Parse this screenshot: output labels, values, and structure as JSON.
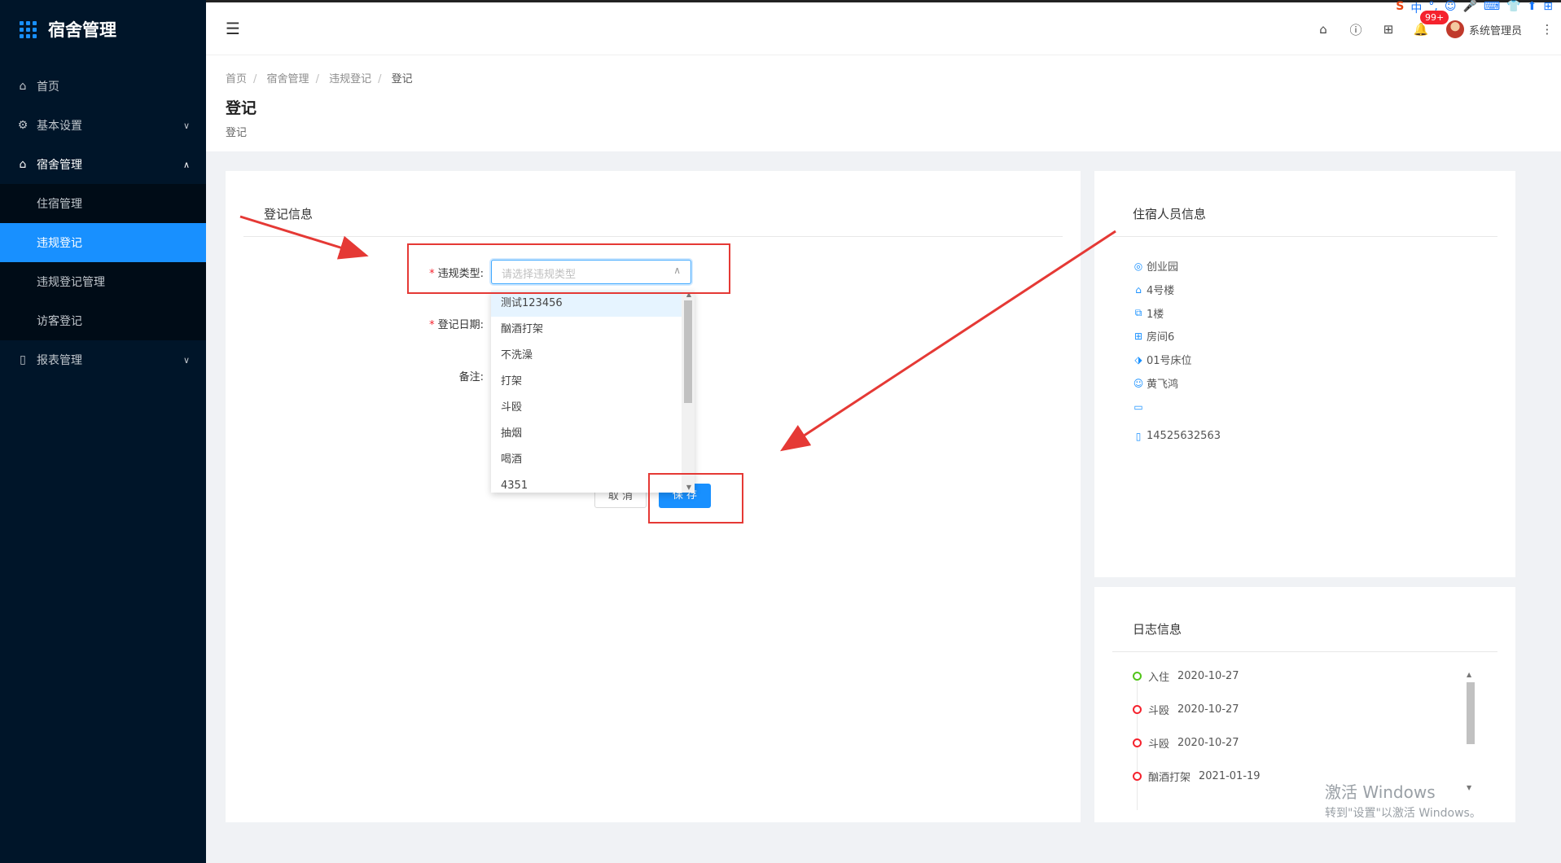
{
  "sidebar": {
    "app_title": "宿舍管理",
    "menu": [
      {
        "label": "首页",
        "icon": "home-icon"
      },
      {
        "label": "基本设置",
        "icon": "gear-icon"
      },
      {
        "label": "宿舍管理",
        "icon": "home-icon"
      },
      {
        "label": "报表管理",
        "icon": "document-icon"
      }
    ],
    "submenu": [
      "住宿管理",
      "违规登记",
      "违规登记管理",
      "访客登记"
    ]
  },
  "header": {
    "notification_badge": "99+",
    "username": "系统管理员",
    "tray": [
      "S",
      "中",
      "°,",
      "☺",
      "🎤",
      "⌨",
      "👕",
      "⬆",
      "⊞"
    ]
  },
  "breadcrumb": [
    "首页",
    "宿舍管理",
    "违规登记",
    "登记"
  ],
  "page": {
    "title": "登记",
    "subtitle": "登记"
  },
  "form": {
    "card_title": "登记信息",
    "labels": {
      "violation_type": "违规类型:",
      "date": "登记日期:",
      "remark": "备注:"
    },
    "violation_type_placeholder": "请选择违规类型",
    "dropdown_options": [
      "测试123456",
      "酗酒打架",
      "不洗澡",
      "打架",
      "斗殴",
      "抽烟",
      "喝酒",
      "4351"
    ],
    "cancel_label": "取 消",
    "save_label": "保 存"
  },
  "resident": {
    "title": "住宿人员信息",
    "campus": "创业园",
    "building": "4号楼",
    "floor": "1楼",
    "room": "房间6",
    "bed": "01号床位",
    "name": "黄飞鸿",
    "id_card": "",
    "phone": "14525632563"
  },
  "log": {
    "title": "日志信息",
    "entries": [
      {
        "action": "入住",
        "date": "2020-10-27",
        "status": "green"
      },
      {
        "action": "斗殴",
        "date": "2020-10-27",
        "status": "red"
      },
      {
        "action": "斗殴",
        "date": "2020-10-27",
        "status": "red"
      },
      {
        "action": "酗酒打架",
        "date": "2021-01-19",
        "status": "red"
      }
    ]
  },
  "watermark": {
    "line1": "激活 Windows",
    "line2": "转到\"设置\"以激活 Windows。"
  },
  "colors": {
    "sidebar_bg": "#001529",
    "accent": "#1890ff",
    "annotation_red": "#e53935"
  }
}
